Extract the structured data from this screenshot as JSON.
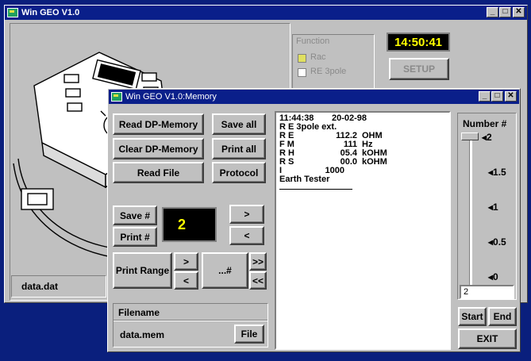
{
  "main_window": {
    "title": "Win GEO V1.0",
    "function_group": {
      "label": "Function",
      "options": [
        "Rac",
        "RE 3pole"
      ]
    },
    "clock": "14:50:41",
    "setup_label": "SETUP",
    "file_label": "data.dat"
  },
  "memory_window": {
    "title": "Win GEO V1.0:Memory",
    "buttons": {
      "read_dp_memory": "Read DP-Memory",
      "clear_dp_memory": "Clear DP-Memory",
      "read_file": "Read File",
      "save_all": "Save all",
      "print_all": "Print all",
      "protocol": "Protocol",
      "save_num": "Save #",
      "print_num": "Print #",
      "next": ">",
      "prev": "<",
      "print_range": "Print Range",
      "range_next": ">",
      "range_prev": "<",
      "range_num": "...#",
      "range_last": ">>",
      "range_first": "<<",
      "file": "File",
      "start": "Start",
      "end": "End",
      "exit": "EXIT"
    },
    "record_number": "2",
    "filename_label": "Filename",
    "filename_value": "data.mem",
    "report": {
      "header_time": "11:44:38",
      "header_date": "20-02-98",
      "method": "R E 3pole ext.",
      "rows": [
        {
          "label": "R E",
          "value": "112.2",
          "unit": "OHM"
        },
        {
          "label": "F M",
          "value": "111",
          "unit": "Hz"
        },
        {
          "label": "R H",
          "value": "05.4",
          "unit": "kOHM"
        },
        {
          "label": "R S",
          "value": "00.0",
          "unit": "kOHM"
        },
        {
          "label": "I",
          "value": "1000",
          "unit": ""
        }
      ],
      "footer": "Earth Tester"
    },
    "slider": {
      "label": "Number #",
      "ticks": [
        "2",
        "1.5",
        "1",
        "0.5",
        "0"
      ],
      "input_value": "2",
      "level": 2,
      "max": 2
    }
  },
  "colors": {
    "desktop": "#0a1f7d",
    "title_bar": "#0a1f8a",
    "window_face": "#c0c0c0",
    "clock_bg": "#000000",
    "clock_fg": "#ffff00",
    "number_fg": "#ffff00"
  }
}
